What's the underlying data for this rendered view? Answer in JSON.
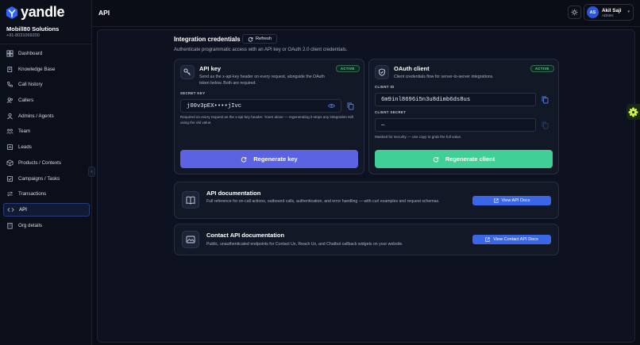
{
  "brand": {
    "name": "yandle"
  },
  "org": {
    "name": "Mobill80 Solutions",
    "phone": "+91-8031069200"
  },
  "nav": [
    {
      "label": "Dashboard",
      "icon": "dashboard-icon",
      "active": false
    },
    {
      "label": "Knowledge Base",
      "icon": "knowledge-base-icon",
      "active": false
    },
    {
      "label": "Call history",
      "icon": "phone-icon",
      "active": false
    },
    {
      "label": "Callers",
      "icon": "users-icon",
      "active": false
    },
    {
      "label": "Admins / Agents",
      "icon": "admins-icon",
      "active": false
    },
    {
      "label": "Team",
      "icon": "team-icon",
      "active": false
    },
    {
      "label": "Leads",
      "icon": "leads-icon",
      "active": false
    },
    {
      "label": "Products / Contexts",
      "icon": "products-icon",
      "active": false
    },
    {
      "label": "Campaigns / Tasks",
      "icon": "campaigns-icon",
      "active": false
    },
    {
      "label": "Transactions",
      "icon": "transactions-icon",
      "active": false
    },
    {
      "label": "API",
      "icon": "api-icon",
      "active": true
    },
    {
      "label": "Org details",
      "icon": "org-icon",
      "active": false
    }
  ],
  "header": {
    "title": "API",
    "user": {
      "initials": "AS",
      "name": "Akil Saji",
      "role": "ADMIN"
    }
  },
  "integration": {
    "title": "Integration credentials",
    "refresh_label": "Refresh",
    "subtitle": "Authenticate programmatic access with an API key or OAuth 2.0 client credentials."
  },
  "api_key_card": {
    "title": "API key",
    "description": "Send as the x-api-key header on every request, alongside the OAuth token below. Both are required.",
    "badge": "ACTIVE",
    "field_label": "SECRET KEY",
    "value": "j00v3pEX••••jIvc",
    "hint": "Required on every request as the x-api-key header. Yours alone — regenerating it stops any integration still using the old value.",
    "button_label": "Regenerate key"
  },
  "oauth_card": {
    "title": "OAuth client",
    "description": "Client credentials flow for server-to-server integrations.",
    "badge": "ACTIVE",
    "client_id_label": "CLIENT ID",
    "client_id_value": "6m9inl8696i5n3u8dimb6ds8us",
    "client_secret_label": "CLIENT SECRET",
    "client_secret_value": "—",
    "hint": "Masked for security — use copy to grab the full value.",
    "button_label": "Regenerate client"
  },
  "docs_card": {
    "title": "API documentation",
    "description": "Full reference for on-call actions, outbound calls, authentication, and error handling — with curl examples and request schemas.",
    "button_label": "View API Docs"
  },
  "contact_docs_card": {
    "title": "Contact API documentation",
    "description": "Public, unauthenticated endpoints for Contact Us, Reach Us, and Chatbot callback widgets on your website.",
    "button_label": "View Contact API Docs"
  },
  "colors": {
    "accent_blue": "#3c66e8",
    "indigo_button": "#5c63e3",
    "teal_button": "#3fcf97",
    "active_badge": "#4fe0a0"
  }
}
